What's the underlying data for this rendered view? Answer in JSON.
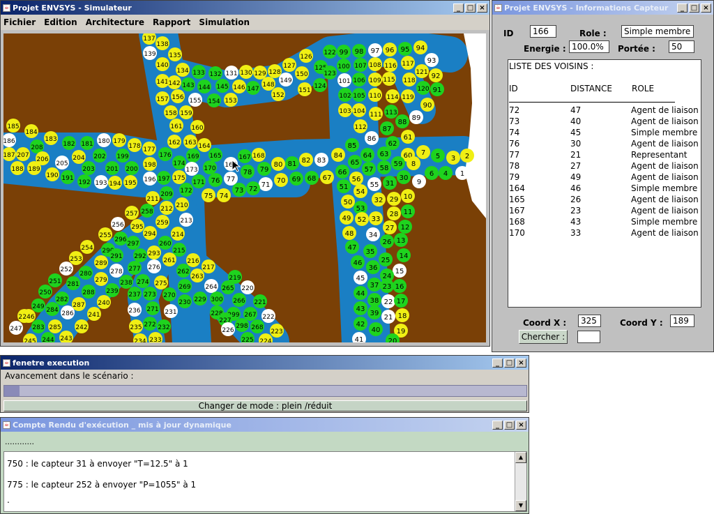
{
  "sim_window": {
    "title": "Projet ENVSYS - Simulateur",
    "menu": [
      "Fichier",
      "Edition",
      "Architecture",
      "Rapport",
      "Simulation"
    ],
    "nodes": [
      [
        "137",
        "y"
      ],
      [
        "138",
        "y"
      ],
      [
        "139",
        "w"
      ],
      [
        "135",
        "y"
      ],
      [
        "140",
        "y"
      ],
      [
        "134",
        "y"
      ],
      [
        "133",
        "g"
      ],
      [
        "132",
        "g"
      ],
      [
        "131",
        "w"
      ],
      [
        "130",
        "y"
      ],
      [
        "129",
        "y"
      ],
      [
        "128",
        "y"
      ],
      [
        "127",
        "y"
      ],
      [
        "126",
        "y"
      ],
      [
        "125",
        "g"
      ],
      [
        "122",
        "g"
      ],
      [
        "99",
        "g"
      ],
      [
        "98",
        "g"
      ],
      [
        "97",
        "w"
      ],
      [
        "96",
        "y"
      ],
      [
        "95",
        "g"
      ],
      [
        "94",
        "y"
      ],
      [
        "93",
        "w"
      ],
      [
        "141",
        "y"
      ],
      [
        "142",
        "y"
      ],
      [
        "143",
        "g"
      ],
      [
        "144",
        "g"
      ],
      [
        "145",
        "g"
      ],
      [
        "146",
        "y"
      ],
      [
        "147",
        "g"
      ],
      [
        "148",
        "y"
      ],
      [
        "149",
        "w"
      ],
      [
        "150",
        "y"
      ],
      [
        "123",
        "g"
      ],
      [
        "100",
        "g"
      ],
      [
        "107",
        "g"
      ],
      [
        "108",
        "y"
      ],
      [
        "116",
        "y"
      ],
      [
        "117",
        "y"
      ],
      [
        "121",
        "y"
      ],
      [
        "92",
        "y"
      ],
      [
        "157",
        "y"
      ],
      [
        "156",
        "y"
      ],
      [
        "155",
        "w"
      ],
      [
        "154",
        "g"
      ],
      [
        "153",
        "y"
      ],
      [
        "152",
        "y"
      ],
      [
        "151",
        "y"
      ],
      [
        "124",
        "g"
      ],
      [
        "101",
        "w"
      ],
      [
        "106",
        "g"
      ],
      [
        "109",
        "y"
      ],
      [
        "115",
        "y"
      ],
      [
        "118",
        "y"
      ],
      [
        "120",
        "g"
      ],
      [
        "91",
        "g"
      ],
      [
        "102",
        "g"
      ],
      [
        "105",
        "g"
      ],
      [
        "110",
        "y"
      ],
      [
        "114",
        "y"
      ],
      [
        "119",
        "y"
      ],
      [
        "90",
        "y"
      ],
      [
        "158",
        "y"
      ],
      [
        "159",
        "y"
      ],
      [
        "103",
        "y"
      ],
      [
        "104",
        "y"
      ],
      [
        "111",
        "y"
      ],
      [
        "113",
        "g"
      ],
      [
        "89",
        "w"
      ],
      [
        "88",
        "g"
      ],
      [
        "185",
        "y"
      ],
      [
        "184",
        "y"
      ],
      [
        "161",
        "y"
      ],
      [
        "160",
        "y"
      ],
      [
        "112",
        "y"
      ],
      [
        "87",
        "g"
      ],
      [
        "186",
        "w"
      ],
      [
        "183",
        "y"
      ],
      [
        "180",
        "w"
      ],
      [
        "179",
        "y"
      ],
      [
        "162",
        "y"
      ],
      [
        "163",
        "y"
      ],
      [
        "86",
        "w"
      ],
      [
        "62",
        "g"
      ],
      [
        "61",
        "y"
      ],
      [
        "182",
        "g"
      ],
      [
        "181",
        "g"
      ],
      [
        "178",
        "y"
      ],
      [
        "177",
        "y"
      ],
      [
        "164",
        "y"
      ],
      [
        "85",
        "g"
      ],
      [
        "187",
        "y"
      ],
      [
        "208",
        "g"
      ],
      [
        "207",
        "y"
      ],
      [
        "206",
        "y"
      ],
      [
        "204",
        "y"
      ],
      [
        "202",
        "g"
      ],
      [
        "199",
        "g"
      ],
      [
        "176",
        "g"
      ],
      [
        "165",
        "g"
      ],
      [
        "167",
        "g"
      ],
      [
        "168",
        "y"
      ],
      [
        "84",
        "y"
      ],
      [
        "63",
        "g"
      ],
      [
        "64",
        "g"
      ],
      [
        "60",
        "y"
      ],
      [
        "7",
        "y"
      ],
      [
        "5",
        "g"
      ],
      [
        "3",
        "y"
      ],
      [
        "2",
        "y"
      ],
      [
        "205",
        "w"
      ],
      [
        "174",
        "g"
      ],
      [
        "169",
        "g"
      ],
      [
        "166",
        "w"
      ],
      [
        "82",
        "y"
      ],
      [
        "83",
        "w"
      ],
      [
        "65",
        "g"
      ],
      [
        "59",
        "g"
      ],
      [
        "8",
        "y"
      ],
      [
        "188",
        "y"
      ],
      [
        "189",
        "y"
      ],
      [
        "203",
        "g"
      ],
      [
        "201",
        "g"
      ],
      [
        "200",
        "g"
      ],
      [
        "198",
        "y"
      ],
      [
        "173",
        "w"
      ],
      [
        "170",
        "g"
      ],
      [
        "78",
        "g"
      ],
      [
        "79",
        "g"
      ],
      [
        "80",
        "y"
      ],
      [
        "81",
        "g"
      ],
      [
        "66",
        "g"
      ],
      [
        "57",
        "g"
      ],
      [
        "58",
        "g"
      ],
      [
        "6",
        "g"
      ],
      [
        "4",
        "g"
      ],
      [
        "1",
        "w"
      ],
      [
        "190",
        "y"
      ],
      [
        "191",
        "g"
      ],
      [
        "192",
        "g"
      ],
      [
        "193",
        "w"
      ],
      [
        "194",
        "y"
      ],
      [
        "195",
        "y"
      ],
      [
        "196",
        "w"
      ],
      [
        "197",
        "g"
      ],
      [
        "175",
        "y"
      ],
      [
        "171",
        "g"
      ],
      [
        "76",
        "g"
      ],
      [
        "77",
        "w"
      ],
      [
        "71",
        "w"
      ],
      [
        "70",
        "y"
      ],
      [
        "69",
        "g"
      ],
      [
        "68",
        "g"
      ],
      [
        "67",
        "y"
      ],
      [
        "56",
        "y"
      ],
      [
        "31",
        "g"
      ],
      [
        "30",
        "g"
      ],
      [
        "9",
        "w"
      ],
      [
        "172",
        "g"
      ],
      [
        "75",
        "y"
      ],
      [
        "74",
        "y"
      ],
      [
        "73",
        "g"
      ],
      [
        "72",
        "g"
      ],
      [
        "55",
        "w"
      ],
      [
        "51",
        "g"
      ],
      [
        "211",
        "y"
      ],
      [
        "209",
        "g"
      ],
      [
        "54",
        "y"
      ],
      [
        "210",
        "y"
      ],
      [
        "212",
        "y"
      ],
      [
        "50",
        "y"
      ],
      [
        "53",
        "g"
      ],
      [
        "32",
        "y"
      ],
      [
        "29",
        "y"
      ],
      [
        "10",
        "y"
      ],
      [
        "257",
        "y"
      ],
      [
        "258",
        "g"
      ],
      [
        "213",
        "w"
      ],
      [
        "11",
        "g"
      ],
      [
        "28",
        "y"
      ],
      [
        "256",
        "w"
      ],
      [
        "295",
        "y"
      ],
      [
        "259",
        "y"
      ],
      [
        "49",
        "y"
      ],
      [
        "52",
        "y"
      ],
      [
        "33",
        "y"
      ],
      [
        "27",
        "y"
      ],
      [
        "12",
        "g"
      ],
      [
        "255",
        "y"
      ],
      [
        "296",
        "g"
      ],
      [
        "294",
        "y"
      ],
      [
        "214",
        "y"
      ],
      [
        "48",
        "y"
      ],
      [
        "34",
        "w"
      ],
      [
        "26",
        "g"
      ],
      [
        "13",
        "g"
      ],
      [
        "254",
        "y"
      ],
      [
        "290",
        "g"
      ],
      [
        "297",
        "g"
      ],
      [
        "260",
        "g"
      ],
      [
        "215",
        "g"
      ],
      [
        "47",
        "g"
      ],
      [
        "35",
        "g"
      ],
      [
        "14",
        "g"
      ],
      [
        "253",
        "y"
      ],
      [
        "289",
        "y"
      ],
      [
        "291",
        "g"
      ],
      [
        "292",
        "g"
      ],
      [
        "293",
        "y"
      ],
      [
        "261",
        "y"
      ],
      [
        "216",
        "y"
      ],
      [
        "46",
        "g"
      ],
      [
        "25",
        "g"
      ],
      [
        "15",
        "w"
      ],
      [
        "252",
        "w"
      ],
      [
        "280",
        "g"
      ],
      [
        "278",
        "w"
      ],
      [
        "277",
        "g"
      ],
      [
        "276",
        "w"
      ],
      [
        "262",
        "g"
      ],
      [
        "263",
        "y"
      ],
      [
        "217",
        "y"
      ],
      [
        "36",
        "g"
      ],
      [
        "24",
        "g"
      ],
      [
        "251",
        "g"
      ],
      [
        "281",
        "g"
      ],
      [
        "279",
        "y"
      ],
      [
        "238",
        "g"
      ],
      [
        "274",
        "g"
      ],
      [
        "275",
        "y"
      ],
      [
        "264",
        "w"
      ],
      [
        "265",
        "g"
      ],
      [
        "219",
        "g"
      ],
      [
        "45",
        "w"
      ],
      [
        "37",
        "g"
      ],
      [
        "23",
        "g"
      ],
      [
        "16",
        "g"
      ],
      [
        "250",
        "g"
      ],
      [
        "288",
        "g"
      ],
      [
        "239",
        "g"
      ],
      [
        "237",
        "g"
      ],
      [
        "273",
        "g"
      ],
      [
        "270",
        "g"
      ],
      [
        "269",
        "g"
      ],
      [
        "220",
        "w"
      ],
      [
        "44",
        "g"
      ],
      [
        "38",
        "g"
      ],
      [
        "22",
        "w"
      ],
      [
        "282",
        "g"
      ],
      [
        "287",
        "y"
      ],
      [
        "240",
        "y"
      ],
      [
        "230",
        "g"
      ],
      [
        "229",
        "g"
      ],
      [
        "300",
        "g"
      ],
      [
        "266",
        "g"
      ],
      [
        "221",
        "g"
      ],
      [
        "17",
        "g"
      ],
      [
        "249",
        "g"
      ],
      [
        "284",
        "g"
      ],
      [
        "286",
        "w"
      ],
      [
        "236",
        "w"
      ],
      [
        "271",
        "g"
      ],
      [
        "231",
        "w"
      ],
      [
        "228",
        "g"
      ],
      [
        "299",
        "g"
      ],
      [
        "267",
        "g"
      ],
      [
        "43",
        "g"
      ],
      [
        "39",
        "g"
      ],
      [
        "21",
        "w"
      ],
      [
        "248",
        "y"
      ],
      [
        "283",
        "g"
      ],
      [
        "285",
        "y"
      ],
      [
        "241",
        "y"
      ],
      [
        "227",
        "g"
      ],
      [
        "18",
        "y"
      ],
      [
        "247",
        "w"
      ],
      [
        "246",
        "y"
      ],
      [
        "242",
        "y"
      ],
      [
        "235",
        "y"
      ],
      [
        "272",
        "g"
      ],
      [
        "232",
        "g"
      ],
      [
        "226",
        "w"
      ],
      [
        "298",
        "g"
      ],
      [
        "268",
        "g"
      ],
      [
        "222",
        "w"
      ],
      [
        "42",
        "g"
      ],
      [
        "40",
        "g"
      ],
      [
        "19",
        "y"
      ],
      [
        "245",
        "y"
      ],
      [
        "244",
        "g"
      ],
      [
        "243",
        "y"
      ],
      [
        "234",
        "y"
      ],
      [
        "233",
        "y"
      ],
      [
        "225",
        "g"
      ],
      [
        "224",
        "y"
      ],
      [
        "223",
        "y"
      ],
      [
        "41",
        "w"
      ],
      [
        "20",
        "g"
      ]
    ]
  },
  "info_window": {
    "title": "Projet ENVSYS - Informations Capteur",
    "id_label": "ID",
    "id_value": "166",
    "role_label": "Role :",
    "role_value": "Simple membre",
    "energie_label": "Energie :",
    "energie_value": "100.0%",
    "portee_label": "Portée :",
    "portee_value": "50",
    "list_title": "LISTE DES VOISINS :",
    "col_id": "ID",
    "col_distance": "DISTANCE",
    "col_role": "ROLE",
    "neighbors": [
      {
        "id": "72",
        "distance": "47",
        "role": "Agent de liaison"
      },
      {
        "id": "73",
        "distance": "40",
        "role": "Agent de liaison"
      },
      {
        "id": "74",
        "distance": "45",
        "role": "Simple membre"
      },
      {
        "id": "76",
        "distance": "30",
        "role": "Agent de liaison"
      },
      {
        "id": "77",
        "distance": "21",
        "role": "Representant"
      },
      {
        "id": "78",
        "distance": "27",
        "role": "Agent de liaison"
      },
      {
        "id": "79",
        "distance": "49",
        "role": "Agent de liaison"
      },
      {
        "id": "164",
        "distance": "46",
        "role": "Simple membre"
      },
      {
        "id": "165",
        "distance": "26",
        "role": "Agent de liaison"
      },
      {
        "id": "167",
        "distance": "23",
        "role": "Agent de liaison"
      },
      {
        "id": "168",
        "distance": "43",
        "role": "Simple membre"
      },
      {
        "id": "170",
        "distance": "33",
        "role": "Agent de liaison"
      }
    ],
    "coordx_label": "Coord X :",
    "coordx_value": "325",
    "coordy_label": "Coord Y :",
    "coordy_value": "189",
    "search_button": "Chercher :",
    "search_value": ""
  },
  "exec_window": {
    "title": "fenetre execution",
    "progress_label": "Avancement dans le scénario :",
    "progress_fraction": 0.03,
    "mode_button": "Changer de mode : plein /réduit"
  },
  "report_window": {
    "title": "Compte Rendu d'exécution _ mis à jour dynamique",
    "dots": "............",
    "lines": [
      "750 : le capteur 31 à envoyer \"T=12.5\" à 1",
      "775 : le capteur 252 à envoyer \"P=1055\" à 1",
      "."
    ]
  },
  "colors": {
    "ground": "#7a4006",
    "road": "#1a7fc4",
    "node_green": "#1ed31e",
    "node_yellow": "#f0ef14",
    "node_white": "#ffffff",
    "report_bg": "#c3d9c3"
  }
}
